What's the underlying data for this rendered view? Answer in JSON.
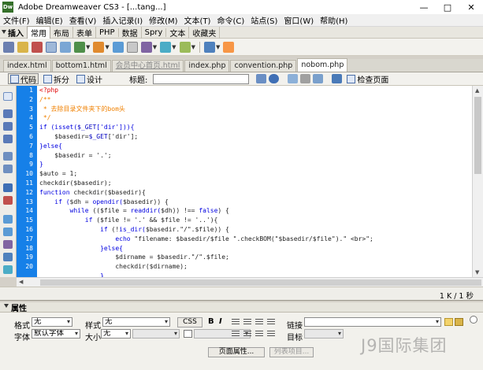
{
  "window": {
    "title": "Adobe Dreamweaver CS3 - [...tang...]",
    "controls": [
      "—",
      "□",
      "✕"
    ]
  },
  "menu": [
    "文件(F)",
    "编辑(E)",
    "查看(V)",
    "插入记录(I)",
    "修改(M)",
    "文本(T)",
    "命令(C)",
    "站点(S)",
    "窗口(W)",
    "帮助(H)"
  ],
  "insert_bar": {
    "title": "插入",
    "tabs": [
      "常用",
      "布局",
      "表单",
      "PHP",
      "数据",
      "Spry",
      "文本",
      "收藏夹"
    ],
    "active_tab": "常用"
  },
  "doc_tabs": [
    {
      "label": "index.html",
      "state": "normal"
    },
    {
      "label": "bottom1.html",
      "state": "normal"
    },
    {
      "label": "会员中心首页.html",
      "state": "dirty"
    },
    {
      "label": "index.php",
      "state": "normal"
    },
    {
      "label": "convention.php",
      "state": "normal"
    },
    {
      "label": "nobom.php",
      "state": "active"
    }
  ],
  "doc_toolbar": {
    "code_label": "代码",
    "split_label": "拆分",
    "design_label": "设计",
    "title_label": "标题:",
    "title_value": "",
    "check_page_label": "检查页面"
  },
  "line_numbers": [
    "1",
    "2",
    "3",
    "4",
    "5",
    "6",
    "7",
    "8",
    "9",
    "10",
    "11",
    "12",
    "13",
    "14",
    "15",
    "16",
    "17",
    "18",
    "19",
    "20"
  ],
  "code_lines": [
    [
      {
        "t": "<?php",
        "c": "tag"
      }
    ],
    [
      {
        "t": "/**",
        "c": "comment"
      }
    ],
    [
      {
        "t": " * 去除目录文件夹下的bom头",
        "c": "comment"
      }
    ],
    [
      {
        "t": " */",
        "c": "comment"
      }
    ],
    [
      {
        "t": "if (isset(",
        "c": "kw"
      },
      {
        "t": "$_GET",
        "c": "var"
      },
      {
        "t": "['dir'])){",
        "c": "kw"
      }
    ],
    [
      {
        "t": "    $basedir=",
        "c": "plain"
      },
      {
        "t": "$_GET",
        "c": "var"
      },
      {
        "t": "['dir'];",
        "c": "plain"
      }
    ],
    [
      {
        "t": "}else{",
        "c": "kw"
      }
    ],
    [
      {
        "t": "    $basedir = '.';",
        "c": "plain"
      }
    ],
    [
      {
        "t": "}",
        "c": "kw"
      }
    ],
    [
      {
        "t": "$auto = 1;",
        "c": "plain"
      }
    ],
    [
      {
        "t": "checkdir($basedir);",
        "c": "plain"
      }
    ],
    [
      {
        "t": "function",
        "c": "kw"
      },
      {
        "t": " checkdir($basedir){",
        "c": "plain"
      }
    ],
    [
      {
        "t": "    if (",
        "c": "kw"
      },
      {
        "t": "$dh = ",
        "c": "plain"
      },
      {
        "t": "opendir(",
        "c": "kw"
      },
      {
        "t": "$basedir)) {",
        "c": "plain"
      }
    ],
    [
      {
        "t": "        while ",
        "c": "kw"
      },
      {
        "t": "(($file = ",
        "c": "plain"
      },
      {
        "t": "readdir(",
        "c": "kw"
      },
      {
        "t": "$dh)) !== ",
        "c": "plain"
      },
      {
        "t": "false",
        "c": "kw"
      },
      {
        "t": ") {",
        "c": "plain"
      }
    ],
    [
      {
        "t": "            if ",
        "c": "kw"
      },
      {
        "t": "($file != '.' && $file != '..'){",
        "c": "plain"
      }
    ],
    [
      {
        "t": "                if ",
        "c": "kw"
      },
      {
        "t": "(!",
        "c": "plain"
      },
      {
        "t": "is_dir(",
        "c": "kw"
      },
      {
        "t": "$basedir.\"/\".$file)) {",
        "c": "plain"
      }
    ],
    [
      {
        "t": "                    echo ",
        "c": "kw"
      },
      {
        "t": "\"filename: $basedir/$file \".checkBOM(\"$basedir/$file\").\" <br>\";",
        "c": "plain"
      }
    ],
    [
      {
        "t": "                }else{",
        "c": "kw"
      }
    ],
    [
      {
        "t": "                    $dirname = $basedir.\"/\".$file;",
        "c": "plain"
      }
    ],
    [
      {
        "t": "                    checkdir($dirname);",
        "c": "plain"
      }
    ],
    [
      {
        "t": "                }",
        "c": "kw"
      }
    ],
    [
      {
        "t": "            }",
        "c": "kw"
      }
    ]
  ],
  "status": {
    "size": "1 K / 1 秒"
  },
  "properties": {
    "title": "属性",
    "format_label": "格式",
    "format_value": "无",
    "style_label": "样式",
    "style_value": "无",
    "css_button": "CSS",
    "bold": "B",
    "italic": "I",
    "link_label": "链接",
    "link_value": "",
    "font_label": "字体",
    "font_value": "默认字体",
    "size_label": "大小",
    "size_value": "无",
    "target_label": "目标",
    "page_props_button": "页面属性...",
    "list_item_button": "列表项目..."
  },
  "watermark": "J9国际集团",
  "colors": {
    "line_number_bg": "#1680e8",
    "tag": "#e00000",
    "comment": "#f08000",
    "keyword": "#0000e0"
  }
}
